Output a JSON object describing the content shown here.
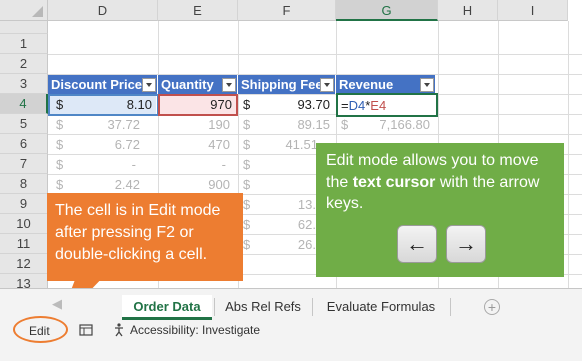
{
  "columns": [
    "D",
    "E",
    "F",
    "G",
    "H",
    "I"
  ],
  "active_column": "G",
  "rows": [
    "1",
    "2",
    "3",
    "4",
    "5",
    "6",
    "7",
    "8",
    "9",
    "10",
    "11",
    "12",
    "13"
  ],
  "active_row": "4",
  "table_headers": [
    "Discount Price",
    "Quantity",
    "Shipping Fee",
    "Revenue"
  ],
  "active_row_values": {
    "currency": "$",
    "discount_price": "8.10",
    "quantity": "970",
    "currency2": "$",
    "shipping_fee": "93.70"
  },
  "formula": {
    "eq": "=",
    "ref1": "D4",
    "op": "*",
    "ref2": "E4"
  },
  "data_rows": [
    {
      "d": "37.72",
      "e": "190",
      "f": "89.15",
      "g": "7,166.80"
    },
    {
      "d": "6.72",
      "e": "470",
      "f": "41.51",
      "g": ""
    },
    {
      "d": "-",
      "e": "-",
      "f": "",
      "g": ""
    },
    {
      "d": "2.42",
      "e": "900",
      "f": "",
      "g": ""
    },
    {
      "d": "",
      "e": "",
      "f": "13.",
      "g": ""
    },
    {
      "d": "",
      "e": "",
      "f": "62.",
      "g": ""
    },
    {
      "d": "",
      "e": "",
      "f": "26.",
      "g": ""
    }
  ],
  "currency_symbol": "$",
  "callouts": {
    "orange": "The cell is in Edit mode after pressing F2 or double-clicking a cell.",
    "green_pre": "Edit mode allows you to move the ",
    "green_bold": "text cursor",
    "green_post": " with the arrow keys."
  },
  "keys": {
    "left": "←",
    "right": "→"
  },
  "sheet_tabs": [
    "Order Data",
    "Abs Rel Refs",
    "Evaluate Formulas"
  ],
  "add_sheet": "+",
  "status": {
    "mode": "Edit",
    "accessibility": "Accessibility: Investigate"
  },
  "colors": {
    "accent": "#217346",
    "table_header": "#4472c4",
    "callout_orange": "#ed7d31",
    "callout_green": "#70ad47"
  }
}
